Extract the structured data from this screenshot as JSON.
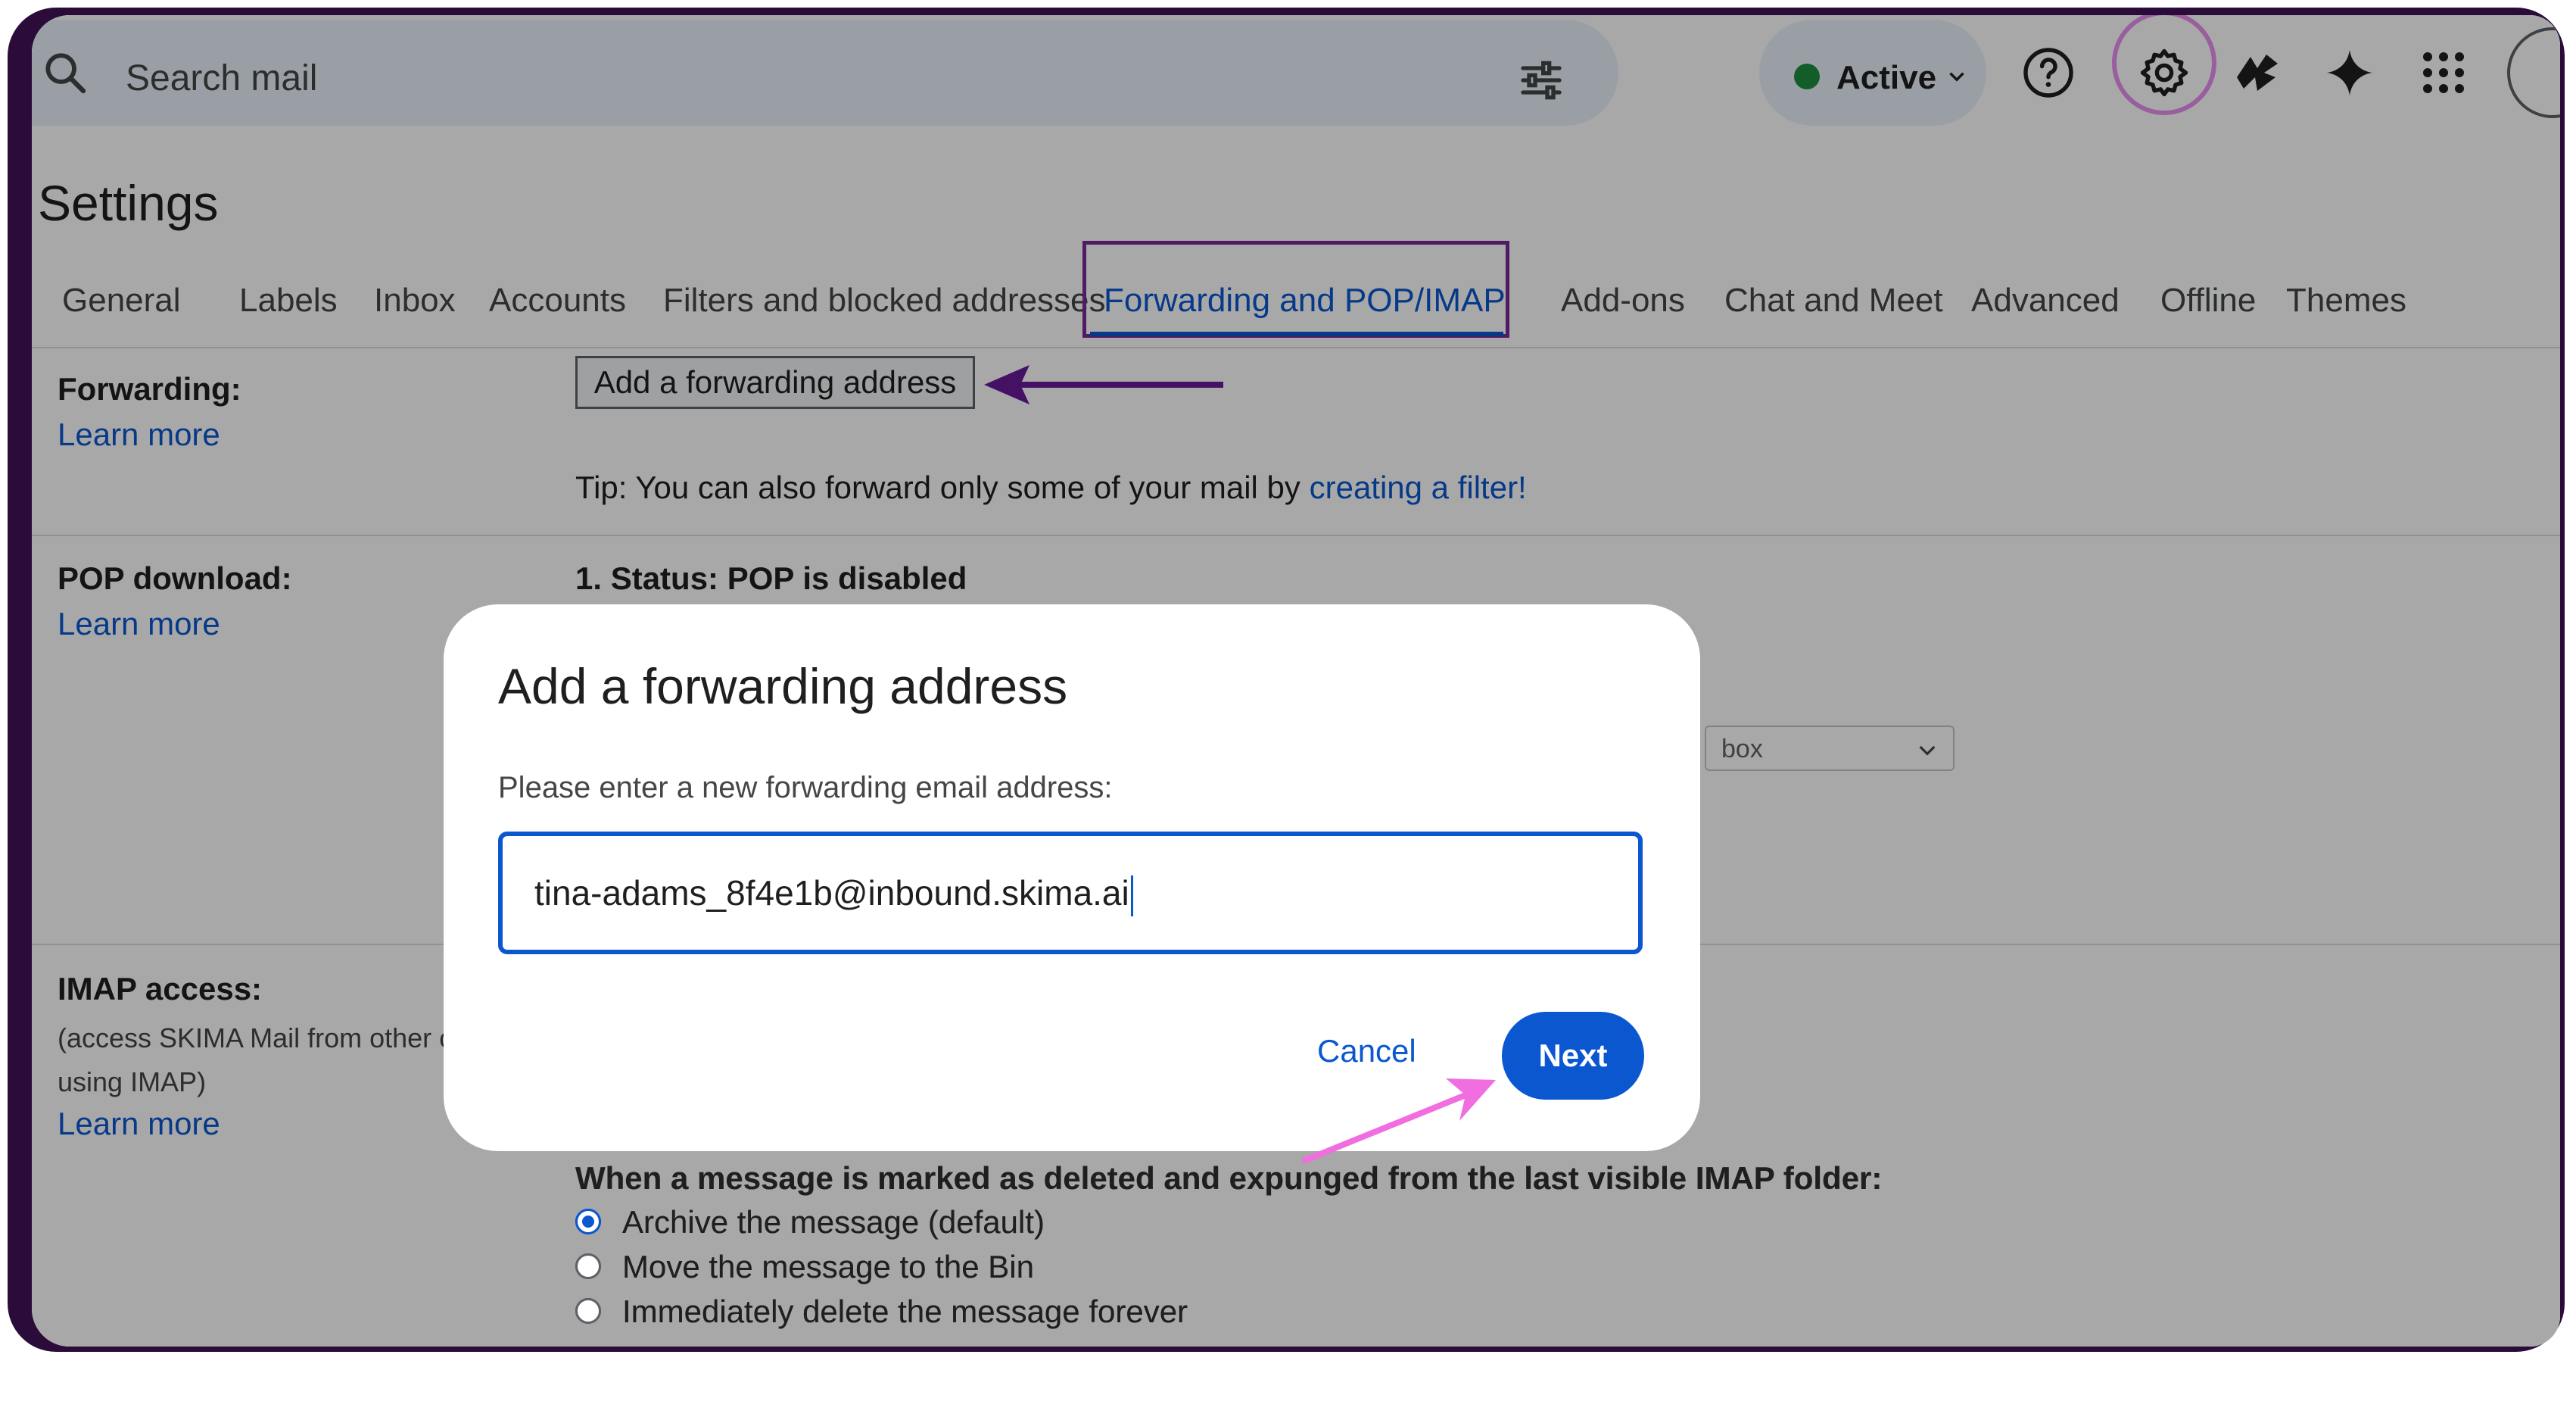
{
  "topbar": {
    "search_placeholder": "Search mail",
    "status_label": "Active",
    "status_color": "#1e8e3e",
    "icons": [
      "search-icon",
      "tune-icon",
      "help-icon",
      "settings-icon",
      "spark-icon",
      "gemini-icon",
      "apps-icon",
      "avatar"
    ]
  },
  "settings": {
    "title": "Settings",
    "tabs": [
      "General",
      "Labels",
      "Inbox",
      "Accounts",
      "Filters and blocked addresses",
      "Forwarding and POP/IMAP",
      "Add-ons",
      "Chat and Meet",
      "Advanced",
      "Offline",
      "Themes"
    ],
    "active_tab": "Forwarding and POP/IMAP"
  },
  "forwarding": {
    "label": "Forwarding:",
    "learn_more": "Learn more",
    "add_button": "Add a forwarding address",
    "tip_prefix": "Tip: You can also forward only some of your mail by",
    "tip_link": "creating a filter!"
  },
  "pop": {
    "label": "POP download:",
    "learn_more": "Learn more",
    "status": "1. Status: POP is disabled",
    "select_value": "box"
  },
  "imap": {
    "label": "IMAP access:",
    "desc_line1": "(access SKIMA Mail from other c",
    "desc_line2": "using IMAP)",
    "learn_more": "Learn more",
    "deleted_heading": "When a message is marked as deleted and expunged from the last visible IMAP folder:",
    "options": [
      "Archive the message (default)",
      "Move the message to the Bin",
      "Immediately delete the message forever"
    ],
    "selected_option": 0
  },
  "dialog": {
    "title": "Add a forwarding address",
    "prompt": "Please enter a new forwarding email address:",
    "input_value": "tina-adams_8f4e1b@inbound.skima.ai",
    "cancel_label": "Cancel",
    "next_label": "Next"
  },
  "annotations": {
    "arrow_color_purple": "#6a1b9a",
    "arrow_color_pink": "#f06ee0",
    "highlight_ring_color": "#e98ff0"
  }
}
